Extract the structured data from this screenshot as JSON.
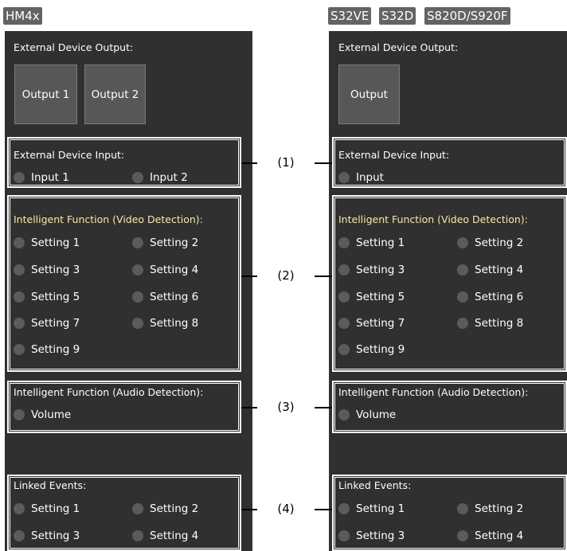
{
  "left_tag": "HM4x",
  "right_tags": [
    "S32VE",
    "S32D",
    "S820D/S920F"
  ],
  "left": {
    "output_title": "External Device Output:",
    "outputs": [
      "Output 1",
      "Output 2"
    ],
    "input_title": "External Device Input:",
    "inputs": [
      "Input 1",
      "Input 2"
    ],
    "video_title": "Intelligent Function (Video Detection):",
    "video_settings": [
      "Setting 1",
      "Setting 2",
      "Setting 3",
      "Setting 4",
      "Setting 5",
      "Setting 6",
      "Setting 7",
      "Setting 8",
      "Setting 9"
    ],
    "audio_title": "Intelligent Function (Audio Detection):",
    "audio_items": [
      "Volume"
    ],
    "linked_title": "Linked Events:",
    "linked_settings": [
      "Setting 1",
      "Setting 2",
      "Setting 3",
      "Setting 4"
    ]
  },
  "right": {
    "output_title": "External Device Output:",
    "outputs": [
      "Output"
    ],
    "input_title": "External Device Input:",
    "inputs": [
      "Input"
    ],
    "video_title": "Intelligent Function (Video Detection):",
    "video_settings": [
      "Setting 1",
      "Setting 2",
      "Setting 3",
      "Setting 4",
      "Setting 5",
      "Setting 6",
      "Setting 7",
      "Setting 8",
      "Setting 9"
    ],
    "audio_title": "Intelligent Function (Audio Detection):",
    "audio_items": [
      "Volume"
    ],
    "linked_title": "Linked Events:",
    "linked_settings": [
      "Setting 1",
      "Setting 2",
      "Setting 3",
      "Setting 4"
    ]
  },
  "callouts": [
    "(1)",
    "(2)",
    "(3)",
    "(4)"
  ],
  "colors": {
    "panel": "#303030",
    "title_yellow": "#f4ec9a",
    "radio": "#5b5b5b",
    "tag": "#636363"
  }
}
